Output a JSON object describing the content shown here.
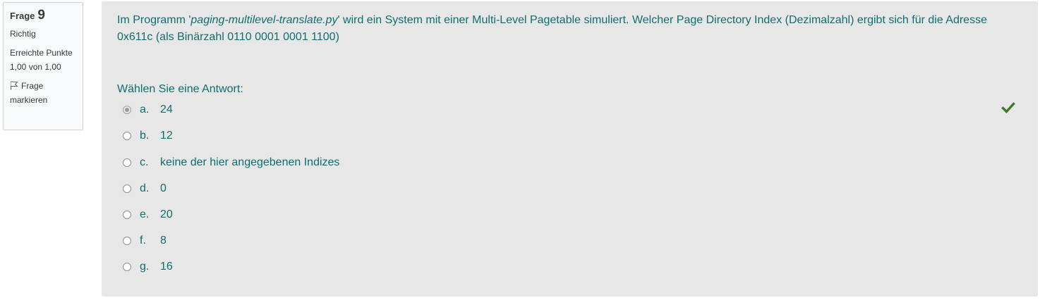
{
  "info": {
    "question_label": "Frage",
    "question_number": "9",
    "state": "Richtig",
    "grade": "Erreichte Punkte 1,00 von 1,00",
    "flag_label": "Frage markieren"
  },
  "question": {
    "text_before": "Im Programm '",
    "program_name": "paging-multilevel-translate.py",
    "text_after": "' wird ein System mit einer Multi-Level Pagetable simuliert. Welcher Page Directory Index (Dezimalzahl) ergibt sich für die Adresse 0x611c (als Binärzahl 0110 0001 0001 1100)",
    "prompt": "Wählen Sie eine Antwort:"
  },
  "answers": [
    {
      "letter": "a.",
      "text": "24"
    },
    {
      "letter": "b.",
      "text": "12"
    },
    {
      "letter": "c.",
      "text": "keine der hier angegebenen Indizes"
    },
    {
      "letter": "d.",
      "text": "0"
    },
    {
      "letter": "e.",
      "text": "20"
    },
    {
      "letter": "f.",
      "text": "8"
    },
    {
      "letter": "g.",
      "text": "16"
    }
  ],
  "selected_answer": "a.",
  "icons": {
    "flag": "flag-icon",
    "correct": "check-icon"
  },
  "colors": {
    "text_accent": "#0f6e6e",
    "panel_background": "#e7e7e7",
    "correct_check": "#3d7a2a"
  }
}
